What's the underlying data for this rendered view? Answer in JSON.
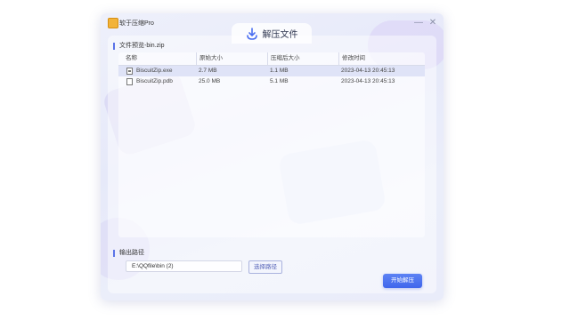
{
  "app": {
    "title": "软于压缩Pro"
  },
  "mode_tab": {
    "label": "解压文件",
    "icon": "download-arrow-icon"
  },
  "preview": {
    "label": "文件预览-bin.zip",
    "columns": [
      "名称",
      "原始大小",
      "压缩后大小",
      "修改时间"
    ],
    "rows": [
      {
        "name": "BiscuitZip.exe",
        "original_size": "2.7 MB",
        "compressed_size": "1.1 MB",
        "modified": "2023-04-13 20:45:13",
        "icon": "exe-file-icon",
        "selected": true
      },
      {
        "name": "BiscuitZip.pdb",
        "original_size": "25.0 MB",
        "compressed_size": "5.1 MB",
        "modified": "2023-04-13 20:45:13",
        "icon": "file-icon",
        "selected": false
      }
    ]
  },
  "output": {
    "label": "输出路径",
    "path_value": "E:\\QQfile\\bin (2)",
    "choose_label": "选择路径"
  },
  "actions": {
    "start_label": "开始解压"
  },
  "colors": {
    "accent": "#4a6ef0",
    "selected_row": "#dfe3f7"
  }
}
